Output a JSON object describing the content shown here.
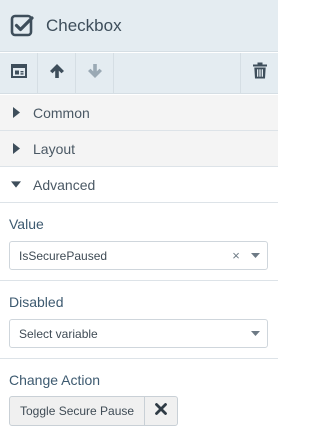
{
  "header": {
    "title": "Checkbox",
    "icon": "checkbox-checked-icon"
  },
  "toolbar": {
    "buttons": [
      {
        "icon": "layout-icon"
      },
      {
        "icon": "arrow-up-icon"
      },
      {
        "icon": "arrow-down-icon"
      },
      {
        "icon": "trash-icon"
      }
    ]
  },
  "sections": [
    {
      "label": "Common",
      "state": "collapsed"
    },
    {
      "label": "Layout",
      "state": "collapsed"
    },
    {
      "label": "Advanced",
      "state": "expanded"
    }
  ],
  "fields": {
    "value": {
      "label": "Value",
      "selected": "IsSecurePaused",
      "clear": "×"
    },
    "disabled": {
      "label": "Disabled",
      "placeholder": "Select variable"
    },
    "change_action": {
      "label": "Change Action",
      "action_name": "Toggle Secure Pause"
    }
  },
  "colors": {
    "icon_dark": "#3e4e5b",
    "icon_light": "#9aa9b4",
    "accent_label": "#3d5a70"
  }
}
